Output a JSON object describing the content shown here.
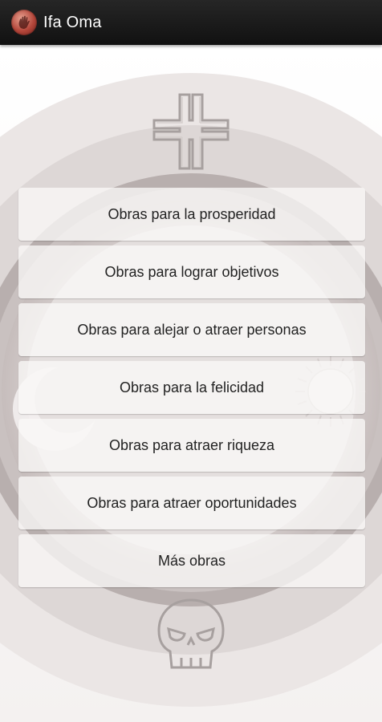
{
  "app": {
    "title": "Ifa Oma",
    "icon": "hand-icon"
  },
  "menu": {
    "items": [
      "Obras para la prosperidad",
      "Obras para lograr objetivos",
      "Obras para alejar o atraer personas",
      "Obras para la felicidad",
      "Obras para atraer riqueza",
      "Obras para atraer oportunidades",
      "Más obras"
    ]
  },
  "colors": {
    "actionbar": "#1f1f1f",
    "background": "#efebea",
    "ring_dark": "#b9b1b0",
    "ring_mid": "#d8d2d1",
    "button": "#faf8f7",
    "text": "#222222"
  }
}
